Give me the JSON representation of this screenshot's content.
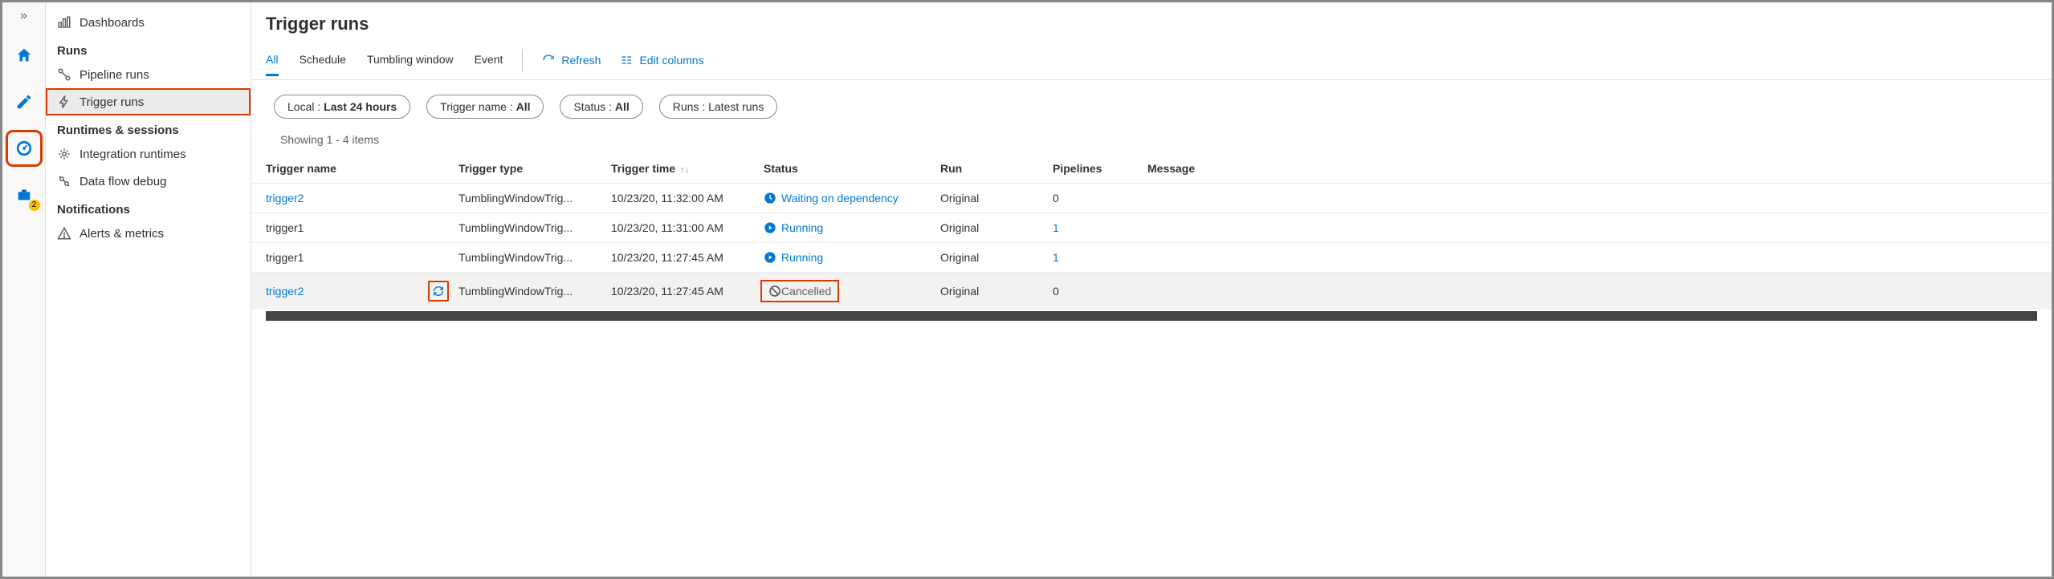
{
  "rail": {
    "items": [
      "home",
      "edit",
      "monitor",
      "toolbox"
    ],
    "badge": "2"
  },
  "sidebar": {
    "dashboards": "Dashboards",
    "groups": {
      "runs": "Runs",
      "runtimes": "Runtimes & sessions",
      "notifications": "Notifications"
    },
    "items": {
      "pipeline_runs": "Pipeline runs",
      "trigger_runs": "Trigger runs",
      "integration_runtimes": "Integration runtimes",
      "data_flow_debug": "Data flow debug",
      "alerts_metrics": "Alerts & metrics"
    }
  },
  "page": {
    "title": "Trigger runs",
    "tabs": {
      "all": "All",
      "schedule": "Schedule",
      "tumbling": "Tumbling window",
      "event": "Event"
    },
    "actions": {
      "refresh": "Refresh",
      "edit_columns": "Edit columns"
    },
    "filters": {
      "local_label": "Local : ",
      "local_value": "Last 24 hours",
      "trigger_label": "Trigger name : ",
      "trigger_value": "All",
      "status_label": "Status : ",
      "status_value": "All",
      "runs_label": "Runs : ",
      "runs_value": "Latest runs"
    },
    "showing": "Showing 1 - 4 items",
    "columns": {
      "trigger_name": "Trigger name",
      "trigger_type": "Trigger type",
      "trigger_time": "Trigger time",
      "status": "Status",
      "run": "Run",
      "pipelines": "Pipelines",
      "message": "Message"
    },
    "rows": [
      {
        "name": "trigger2",
        "name_link": true,
        "type": "TumblingWindowTrig...",
        "time": "10/23/20, 11:32:00 AM",
        "status": "Waiting on dependency",
        "status_kind": "waiting",
        "run": "Original",
        "pipelines": "0",
        "pipelines_link": false
      },
      {
        "name": "trigger1",
        "name_link": false,
        "type": "TumblingWindowTrig...",
        "time": "10/23/20, 11:31:00 AM",
        "status": "Running",
        "status_kind": "running",
        "run": "Original",
        "pipelines": "1",
        "pipelines_link": true
      },
      {
        "name": "trigger1",
        "name_link": false,
        "type": "TumblingWindowTrig...",
        "time": "10/23/20, 11:27:45 AM",
        "status": "Running",
        "status_kind": "running",
        "run": "Original",
        "pipelines": "1",
        "pipelines_link": true
      },
      {
        "name": "trigger2",
        "name_link": true,
        "type": "TumblingWindowTrig...",
        "time": "10/23/20, 11:27:45 AM",
        "status": "Cancelled",
        "status_kind": "cancelled",
        "run": "Original",
        "pipelines": "0",
        "pipelines_link": false
      }
    ]
  }
}
